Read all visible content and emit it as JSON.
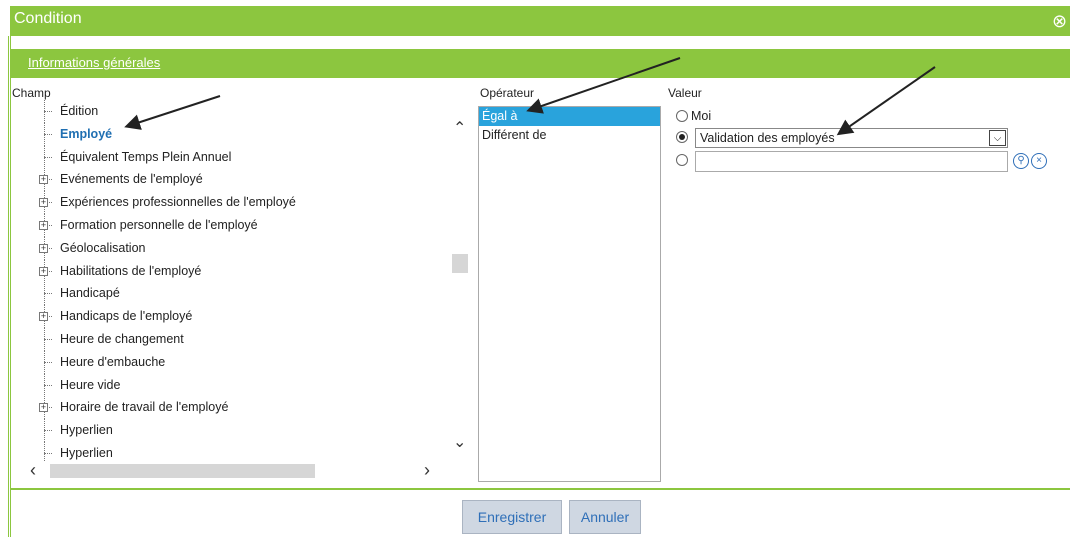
{
  "window": {
    "title": "Condition",
    "close_icon": "close-icon"
  },
  "section": {
    "title": "Informations générales"
  },
  "champ": {
    "label": "Champ",
    "items": [
      {
        "label": "Édition",
        "expandable": false,
        "selected": false
      },
      {
        "label": "Employé",
        "expandable": false,
        "selected": true
      },
      {
        "label": "Équivalent Temps Plein Annuel",
        "expandable": false,
        "selected": false
      },
      {
        "label": "Evénements de l'employé",
        "expandable": true,
        "selected": false
      },
      {
        "label": "Expériences professionnelles de l'employé",
        "expandable": true,
        "selected": false
      },
      {
        "label": "Formation personnelle de l'employé",
        "expandable": true,
        "selected": false
      },
      {
        "label": "Géolocalisation",
        "expandable": true,
        "selected": false
      },
      {
        "label": "Habilitations de l'employé",
        "expandable": true,
        "selected": false
      },
      {
        "label": "Handicapé",
        "expandable": false,
        "selected": false
      },
      {
        "label": "Handicaps de l'employé",
        "expandable": true,
        "selected": false
      },
      {
        "label": "Heure de changement",
        "expandable": false,
        "selected": false
      },
      {
        "label": "Heure d'embauche",
        "expandable": false,
        "selected": false
      },
      {
        "label": "Heure vide",
        "expandable": false,
        "selected": false
      },
      {
        "label": "Horaire de travail de l'employé",
        "expandable": true,
        "selected": false
      },
      {
        "label": "Hyperlien",
        "expandable": false,
        "selected": false
      },
      {
        "label": "Hyperlien",
        "expandable": false,
        "selected": false
      }
    ]
  },
  "operateur": {
    "label": "Opérateur",
    "items": [
      {
        "label": "Égal à",
        "selected": true
      },
      {
        "label": "Différent de",
        "selected": false
      }
    ]
  },
  "valeur": {
    "label": "Valeur",
    "moi_label": "Moi",
    "selected_option": "Validation des employés",
    "text_value": ""
  },
  "buttons": {
    "save": "Enregistrer",
    "cancel": "Annuler"
  },
  "colors": {
    "accent": "#8cc63f",
    "selection": "#29a3dc",
    "link_blue": "#2f6fb8"
  }
}
